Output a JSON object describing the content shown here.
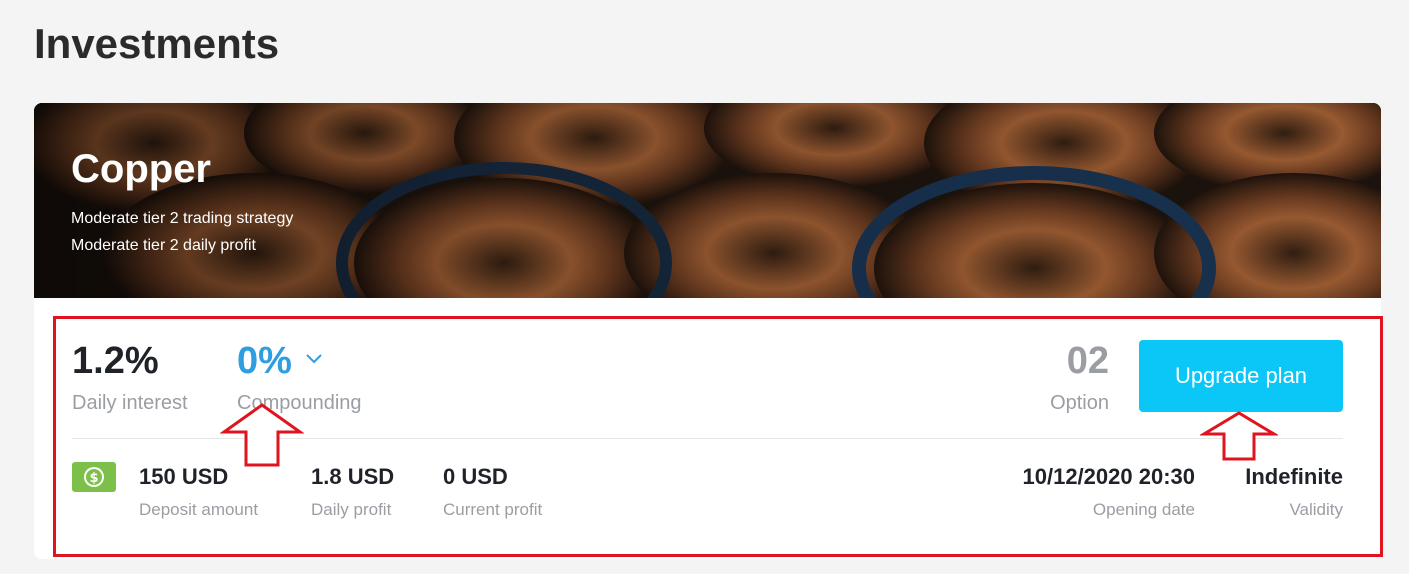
{
  "page": {
    "title": "Investments"
  },
  "plan": {
    "name": "Copper",
    "description_1": "Moderate tier 2 trading strategy",
    "description_2": "Moderate tier 2 daily profit"
  },
  "stats": {
    "daily_interest_value": "1.2%",
    "daily_interest_label": "Daily interest",
    "compounding_value": "0%",
    "compounding_label": "Compounding",
    "option_value": "02",
    "option_label": "Option",
    "upgrade_label": "Upgrade plan"
  },
  "details": {
    "deposit_value": "150 USD",
    "deposit_label": "Deposit amount",
    "daily_profit_value": "1.8 USD",
    "daily_profit_label": "Daily profit",
    "current_profit_value": "0 USD",
    "current_profit_label": "Current profit",
    "opening_date_value": "10/12/2020 20:30",
    "opening_date_label": "Opening date",
    "validity_value": "Indefinite",
    "validity_label": "Validity"
  },
  "icons": {
    "compounding_toggle": "chevron-down-icon",
    "deposit": "money-icon",
    "annotation": "arrow-up-icon"
  },
  "colors": {
    "accent_blue": "#2e9ee0",
    "button": "#0bc7f7",
    "highlight": "#e0141e",
    "money_icon": "#7cc04a"
  }
}
